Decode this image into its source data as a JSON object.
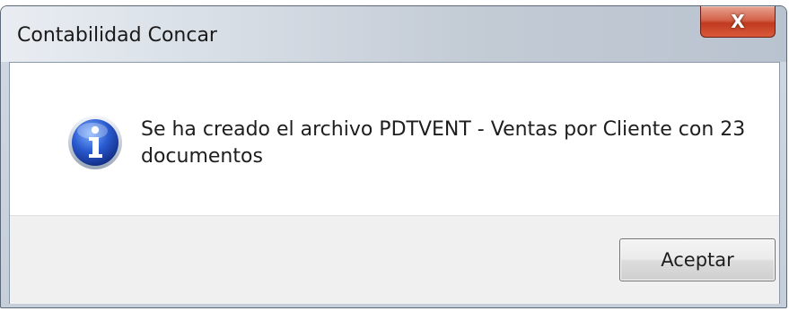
{
  "window": {
    "title": "Contabilidad Concar",
    "close_label": "X"
  },
  "dialog": {
    "icon": "information-icon",
    "message": "Se ha creado el archivo PDTVENT - Ventas por Cliente con 23 documentos",
    "ok_label": "Aceptar"
  },
  "colors": {
    "close_button": "#c8482c",
    "info_icon": "#2a5bd0"
  }
}
